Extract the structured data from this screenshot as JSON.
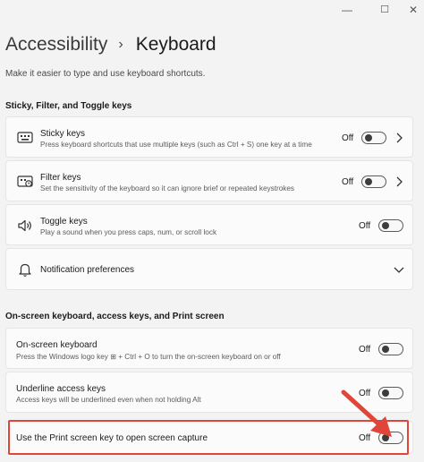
{
  "window": {
    "minimize_glyph": "—",
    "maximize_glyph": "☐",
    "close_glyph": "✕"
  },
  "breadcrumb": {
    "parent": "Accessibility",
    "separator": "›",
    "current": "Keyboard"
  },
  "subtitle": "Make it easier to type and use keyboard shortcuts.",
  "sections": {
    "sticky_filter_toggle": "Sticky, Filter, and Toggle keys",
    "onscreen": "On-screen keyboard, access keys, and Print screen"
  },
  "settings": {
    "sticky_keys": {
      "title": "Sticky keys",
      "desc": "Press keyboard shortcuts that use multiple keys (such as Ctrl + S) one key at a time",
      "state": "Off",
      "icon": "keyboard-icon"
    },
    "filter_keys": {
      "title": "Filter keys",
      "desc": "Set the sensitivity of the keyboard so it can ignore brief or repeated keystrokes",
      "state": "Off",
      "icon": "keyboard-timer-icon"
    },
    "toggle_keys": {
      "title": "Toggle keys",
      "desc": "Play a sound when you press caps, num, or scroll lock",
      "state": "Off",
      "icon": "speaker-icon"
    },
    "notification_prefs": {
      "title": "Notification preferences",
      "icon": "bell-icon"
    },
    "onscreen_keyboard": {
      "title": "On-screen keyboard",
      "desc": "Press the Windows logo key ⊞ + Ctrl + O to turn the on-screen keyboard on or off",
      "state": "Off"
    },
    "underline_access_keys": {
      "title": "Underline access keys",
      "desc": "Access keys will be underlined even when not holding Alt",
      "state": "Off"
    },
    "print_screen": {
      "title": "Use the Print screen key to open screen capture",
      "state": "Off"
    }
  },
  "colors": {
    "background": "#f3f3f3",
    "card": "#fbfbfb",
    "highlight": "#e0453a"
  }
}
